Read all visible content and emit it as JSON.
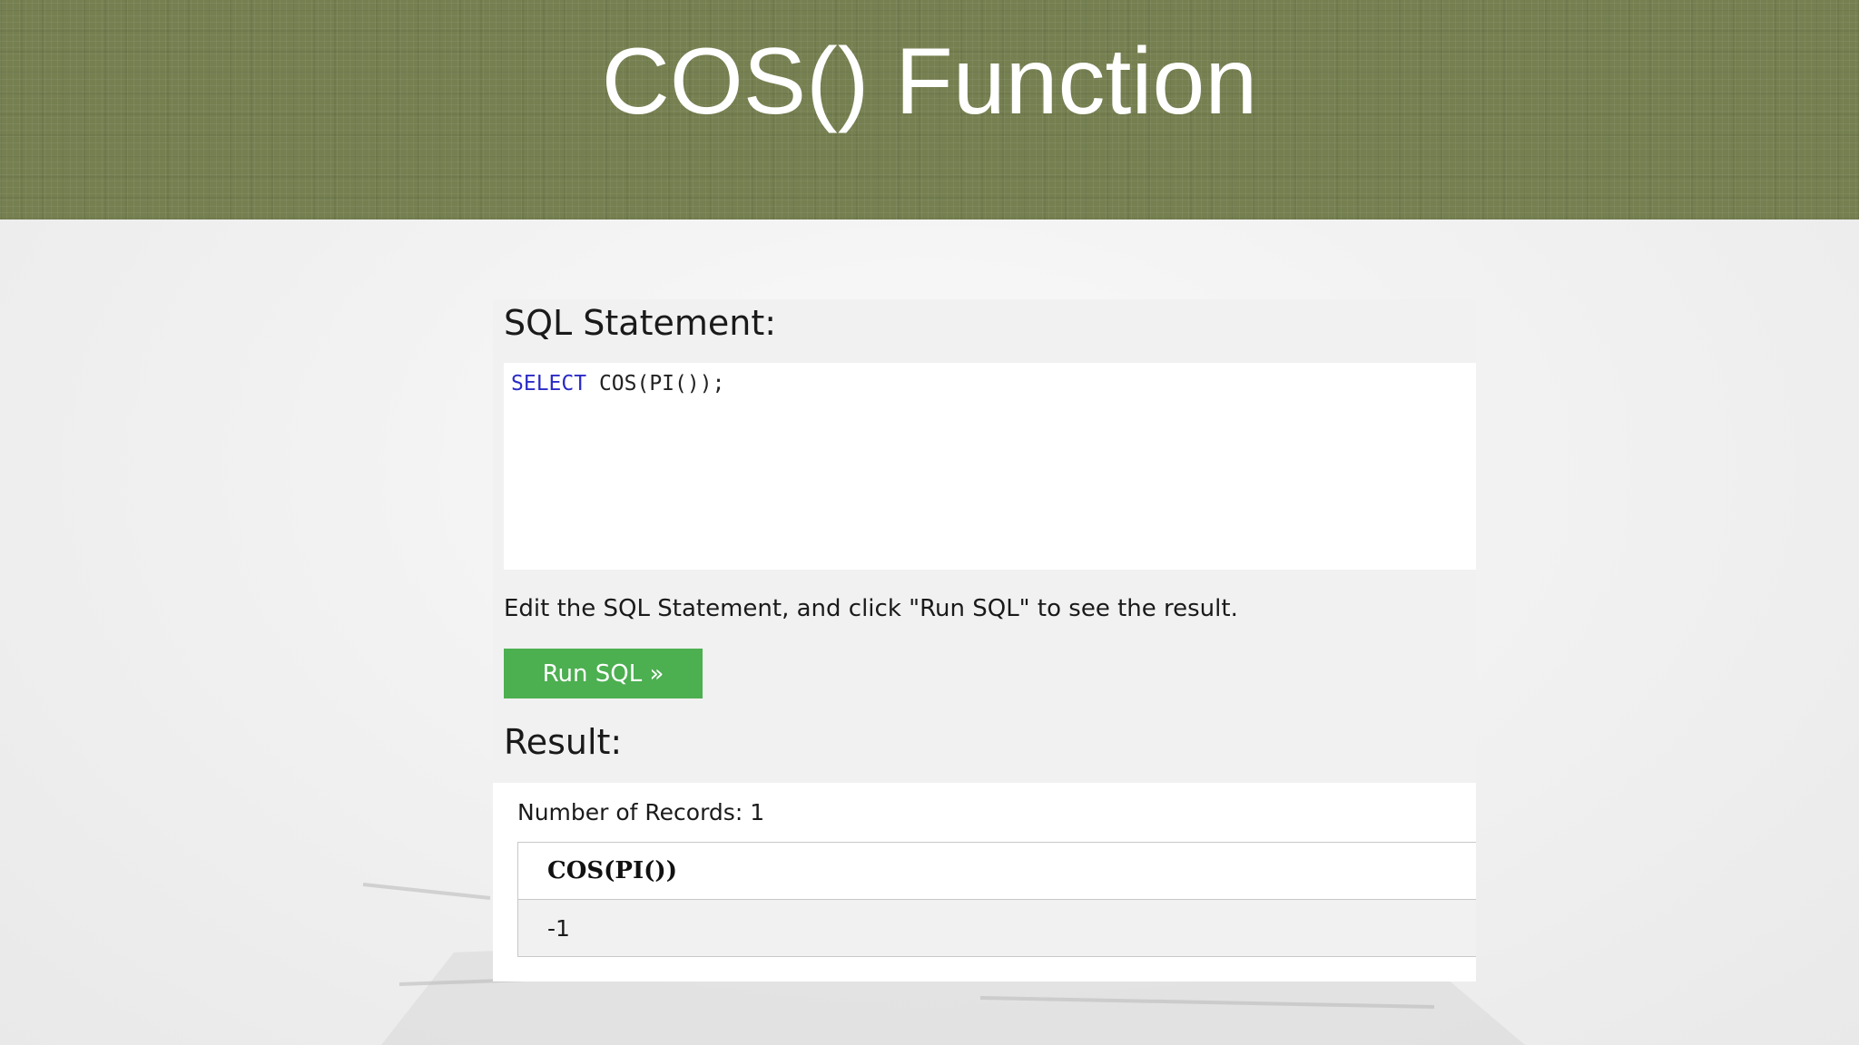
{
  "banner": {
    "title": "COS() Function"
  },
  "editor_section": {
    "heading": "SQL Statement:",
    "keyword": "SELECT",
    "code_rest": " COS(PI());"
  },
  "hint_text": "Edit the SQL Statement, and click \"Run SQL\" to see the result.",
  "run_button": {
    "label": "Run SQL »",
    "color": "#4caf50"
  },
  "result_section": {
    "heading": "Result:",
    "records_text": "Number of Records: 1",
    "columns": [
      "COS(PI())"
    ],
    "rows": [
      [
        "-1"
      ]
    ]
  },
  "colors": {
    "banner": "#757f50",
    "sql_keyword": "#2b2bc7"
  }
}
